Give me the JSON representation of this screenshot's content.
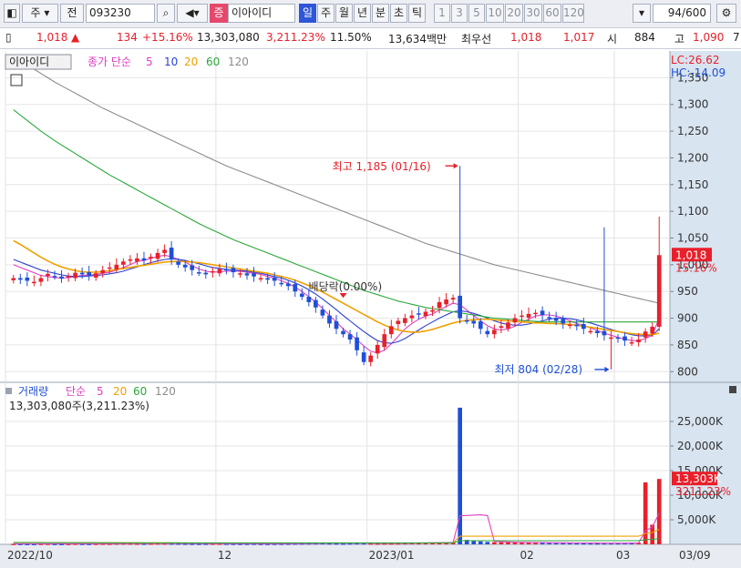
{
  "toolbar": {
    "market": "주",
    "prefix": "전",
    "code": "093230",
    "fav_badge": "증",
    "name": "이아이디",
    "periods": [
      "일",
      "주",
      "월",
      "년",
      "분",
      "초",
      "틱"
    ],
    "active_period": "일",
    "minutes": [
      "1",
      "3",
      "5",
      "10",
      "20",
      "30",
      "60",
      "120"
    ],
    "count": "94/600"
  },
  "quote": {
    "price": "1,018",
    "arrow": "▲",
    "change": "134",
    "change_pct": "+15.16%",
    "volume": "13,303,080",
    "volume_pct": "3,211.23%",
    "turnover": "11.50%",
    "amount": "13,634백만",
    "best_label": "최우선",
    "ask": "1,018",
    "bid": "1,017",
    "open_label": "시",
    "open": "884",
    "high_label": "고",
    "high": "1,090",
    "tail": "7"
  },
  "price_panel": {
    "name_tag": "이아이디",
    "legend_prefix": "종가 단순",
    "ma_periods": [
      "5",
      "10",
      "20",
      "60",
      "120"
    ],
    "ma_colors": [
      "#e040c0",
      "#2b3fd0",
      "#f0a000",
      "#2aa838",
      "#8c8c8c"
    ],
    "lc": "LC:26.62",
    "hc": "HC:-14.09",
    "current_price": "1,018",
    "current_pct": "15.16%",
    "high_annotation": "최고 1,185 (01/16)",
    "low_annotation": "최저 804 (02/28)",
    "ex_annotation": "배당락(0.00%)"
  },
  "volume_panel": {
    "title": "거래량",
    "legend_prefix": "단순",
    "ma_periods": [
      "5",
      "20",
      "60",
      "120"
    ],
    "ma_colors": [
      "#e040c0",
      "#f0a000",
      "#2aa838",
      "#8c8c8c"
    ],
    "current_volume_text": "13,303,080주(3,211.23%)",
    "current_volume": "13,303K",
    "current_pct": "3211.23%"
  },
  "x_labels": [
    "2022/10",
    "12",
    "2023/01",
    "02",
    "03",
    "03/09"
  ],
  "chart_data": [
    {
      "type": "candlestick",
      "title": "이아이디",
      "y_ticks": [
        800,
        850,
        900,
        950,
        1000,
        1050,
        1100,
        1150,
        1200,
        1250,
        1300,
        1350
      ],
      "ylim": [
        780,
        1400
      ],
      "last_close": 1018,
      "high_point": {
        "value": 1185,
        "date": "01/16"
      },
      "low_point": {
        "value": 804,
        "date": "02/28"
      },
      "closes": [
        975,
        972,
        970,
        968,
        975,
        983,
        978,
        974,
        979,
        985,
        982,
        980,
        984,
        990,
        995,
        1000,
        1006,
        1010,
        1012,
        1008,
        1015,
        1022,
        1028,
        1010,
        1000,
        995,
        990,
        985,
        982,
        988,
        992,
        990,
        986,
        984,
        980,
        978,
        975,
        972,
        970,
        965,
        960,
        950,
        940,
        930,
        920,
        905,
        890,
        880,
        870,
        860,
        840,
        818,
        830,
        850,
        870,
        885,
        895,
        900,
        905,
        908,
        912,
        915,
        930,
        935,
        938,
        900,
        895,
        890,
        880,
        870,
        878,
        885,
        892,
        900,
        905,
        908,
        910,
        906,
        900,
        895,
        890,
        888,
        885,
        880,
        876,
        872,
        868,
        864,
        862,
        858,
        855,
        860,
        875,
        884,
        1018
      ],
      "ma_series": [
        {
          "name": "5",
          "values": [
            1000,
            995,
            990,
            985,
            980,
            978,
            976,
            975,
            976,
            978,
            980,
            981,
            982,
            984,
            986,
            990,
            995,
            1000,
            1006,
            1008,
            1012,
            1015,
            1018,
            1015,
            1010,
            1005,
            998,
            992,
            988,
            986,
            987,
            988,
            988,
            988,
            986,
            984,
            982,
            978,
            975,
            970,
            965,
            958,
            950,
            940,
            930,
            918,
            905,
            893,
            880,
            870,
            860,
            848,
            838,
            835,
            840,
            852,
            866,
            880,
            890,
            898,
            904,
            908,
            915,
            922,
            928,
            925,
            915,
            905,
            895,
            886,
            880,
            878,
            880,
            885,
            892,
            898,
            904,
            906,
            906,
            904,
            900,
            895,
            890,
            886,
            882,
            877,
            872,
            868,
            864,
            861,
            858,
            858,
            862,
            868,
            900
          ]
        },
        {
          "name": "10",
          "values": [
            1010,
            1005,
            1000,
            995,
            990,
            987,
            984,
            981,
            979,
            978,
            978,
            979,
            980,
            981,
            983,
            985,
            988,
            992,
            996,
            1000,
            1004,
            1007,
            1010,
            1011,
            1010,
            1008,
            1005,
            1002,
            998,
            995,
            993,
            991,
            990,
            989,
            988,
            986,
            984,
            981,
            978,
            975,
            971,
            966,
            960,
            953,
            945,
            936,
            926,
            916,
            905,
            895,
            885,
            875,
            866,
            858,
            854,
            853,
            856,
            862,
            870,
            878,
            886,
            893,
            900,
            906,
            912,
            914,
            912,
            909,
            905,
            900,
            895,
            891,
            888,
            887,
            887,
            889,
            892,
            895,
            898,
            900,
            900,
            899,
            897,
            894,
            891,
            887,
            883,
            879,
            875,
            872,
            869,
            867,
            867,
            868,
            880
          ]
        },
        {
          "name": "20",
          "values": [
            1045,
            1038,
            1030,
            1022,
            1014,
            1007,
            1001,
            996,
            992,
            989,
            987,
            986,
            986,
            987,
            989,
            991,
            993,
            995,
            997,
            999,
            1001,
            1003,
            1005,
            1006,
            1006,
            1006,
            1005,
            1004,
            1002,
            1000,
            998,
            996,
            994,
            992,
            990,
            988,
            986,
            984,
            981,
            978,
            975,
            971,
            966,
            961,
            955,
            949,
            942,
            935,
            928,
            921,
            914,
            907,
            900,
            893,
            887,
            882,
            878,
            875,
            874,
            874,
            876,
            879,
            883,
            887,
            891,
            894,
            896,
            897,
            898,
            898,
            897,
            896,
            895,
            894,
            893,
            892,
            891,
            891,
            890,
            890,
            889,
            888,
            887,
            885,
            883,
            881,
            879,
            877,
            875,
            873,
            871,
            870,
            869,
            869,
            872
          ]
        },
        {
          "name": "60",
          "values": [
            1290,
            1280,
            1270,
            1260,
            1250,
            1241,
            1232,
            1224,
            1216,
            1208,
            1200,
            1192,
            1184,
            1176,
            1168,
            1161,
            1154,
            1147,
            1140,
            1133,
            1126,
            1119,
            1112,
            1105,
            1098,
            1091,
            1084,
            1077,
            1071,
            1065,
            1059,
            1053,
            1047,
            1042,
            1037,
            1032,
            1027,
            1022,
            1017,
            1012,
            1007,
            1002,
            997,
            992,
            987,
            982,
            977,
            972,
            967,
            962,
            957,
            952,
            948,
            944,
            940,
            936,
            932,
            929,
            926,
            923,
            920,
            918,
            916,
            914,
            912,
            910,
            908,
            906,
            904,
            902,
            900,
            899,
            898,
            897,
            896,
            895,
            894,
            893,
            893,
            893,
            893,
            893,
            893,
            893,
            893,
            893,
            893,
            893,
            893,
            893,
            893,
            893,
            893,
            893,
            893
          ]
        },
        {
          "name": "120",
          "values": [
            1390,
            1382,
            1374,
            1366,
            1358,
            1350,
            1342,
            1335,
            1328,
            1321,
            1314,
            1307,
            1300,
            1293,
            1287,
            1281,
            1275,
            1269,
            1263,
            1257,
            1251,
            1245,
            1239,
            1233,
            1227,
            1221,
            1215,
            1209,
            1203,
            1197,
            1191,
            1185,
            1180,
            1175,
            1170,
            1165,
            1160,
            1155,
            1150,
            1145,
            1140,
            1135,
            1130,
            1125,
            1120,
            1115,
            1110,
            1105,
            1100,
            1095,
            1090,
            1085,
            1080,
            1075,
            1070,
            1065,
            1060,
            1055,
            1050,
            1045,
            1040,
            1036,
            1032,
            1028,
            1024,
            1020,
            1016,
            1012,
            1008,
            1004,
            1000,
            997,
            994,
            991,
            988,
            985,
            982,
            979,
            976,
            973,
            970,
            967,
            964,
            961,
            958,
            955,
            952,
            949,
            946,
            943,
            940,
            937,
            934,
            931,
            928
          ]
        }
      ]
    },
    {
      "type": "bar",
      "title": "거래량",
      "y_ticks": [
        "5,000K",
        "10,000K",
        "15,000K",
        "20,000K",
        "25,000K"
      ],
      "tick_values": [
        5000,
        10000,
        15000,
        20000,
        25000
      ],
      "ylim": [
        0,
        30000
      ],
      "unit": "K",
      "values": [
        120,
        110,
        100,
        95,
        130,
        140,
        110,
        100,
        120,
        150,
        130,
        120,
        140,
        160,
        150,
        180,
        200,
        190,
        170,
        160,
        180,
        220,
        210,
        190,
        180,
        160,
        150,
        140,
        150,
        160,
        170,
        150,
        140,
        130,
        140,
        150,
        130,
        120,
        140,
        150,
        160,
        180,
        200,
        220,
        240,
        260,
        230,
        200,
        180,
        220,
        260,
        240,
        210,
        190,
        200,
        210,
        230,
        260,
        280,
        300,
        320,
        340,
        360,
        380,
        400,
        27800,
        900,
        700,
        600,
        500,
        450,
        420,
        400,
        380,
        360,
        340,
        330,
        320,
        300,
        290,
        280,
        270,
        260,
        250,
        240,
        230,
        240,
        250,
        260,
        280,
        300,
        320,
        12600,
        4000,
        13303
      ],
      "ma_series": [
        {
          "name": "5",
          "values": [
            120,
            118,
            115,
            112,
            111,
            117,
            122,
            124,
            120,
            124,
            130,
            134,
            134,
            140,
            144,
            152,
            166,
            176,
            180,
            180,
            180,
            186,
            188,
            188,
            186,
            184,
            178,
            168,
            160,
            154,
            154,
            154,
            154,
            150,
            146,
            148,
            146,
            138,
            136,
            140,
            144,
            152,
            166,
            182,
            200,
            220,
            234,
            238,
            232,
            228,
            236,
            240,
            228,
            220,
            224,
            230,
            232,
            230,
            240,
            264,
            290,
            312,
            340,
            360,
            380,
            5808,
            5864,
            5936,
            5996,
            5860,
            630,
            534,
            474,
            430,
            402,
            384,
            366,
            350,
            330,
            318,
            308,
            294,
            280,
            270,
            260,
            250,
            246,
            244,
            244,
            248,
            256,
            270,
            2774,
            3500,
            6357
          ]
        },
        {
          "name": "20",
          "values": [
            400,
            395,
            390,
            385,
            380,
            375,
            370,
            365,
            360,
            355,
            350,
            345,
            340,
            335,
            330,
            325,
            320,
            315,
            310,
            305,
            300,
            298,
            296,
            294,
            292,
            290,
            288,
            286,
            284,
            282,
            280,
            279,
            278,
            277,
            276,
            275,
            274,
            273,
            272,
            271,
            270,
            270,
            270,
            270,
            270,
            270,
            270,
            270,
            270,
            270,
            270,
            270,
            270,
            270,
            270,
            270,
            270,
            270,
            270,
            270,
            270,
            270,
            270,
            270,
            270,
            1650,
            1650,
            1650,
            1650,
            1650,
            1650,
            1650,
            1650,
            1650,
            1650,
            1650,
            1650,
            1650,
            1650,
            1650,
            1650,
            1650,
            1650,
            1650,
            1650,
            1650,
            1650,
            1650,
            1650,
            1650,
            1650,
            1650,
            2200,
            2400,
            3050
          ]
        },
        {
          "name": "60",
          "values": [
            350,
            348,
            346,
            344,
            342,
            340,
            338,
            336,
            334,
            332,
            330,
            328,
            326,
            324,
            322,
            320,
            318,
            316,
            314,
            312,
            310,
            309,
            308,
            307,
            306,
            305,
            304,
            303,
            302,
            301,
            300,
            299,
            298,
            297,
            296,
            295,
            294,
            293,
            292,
            291,
            290,
            290,
            290,
            290,
            290,
            290,
            290,
            290,
            290,
            290,
            290,
            290,
            290,
            290,
            290,
            290,
            290,
            290,
            290,
            290,
            290,
            290,
            290,
            290,
            290,
            750,
            750,
            750,
            750,
            750,
            750,
            750,
            750,
            750,
            750,
            750,
            750,
            750,
            750,
            750,
            750,
            750,
            750,
            750,
            750,
            750,
            750,
            750,
            750,
            750,
            750,
            750,
            950,
            1000,
            1200
          ]
        }
      ]
    }
  ]
}
